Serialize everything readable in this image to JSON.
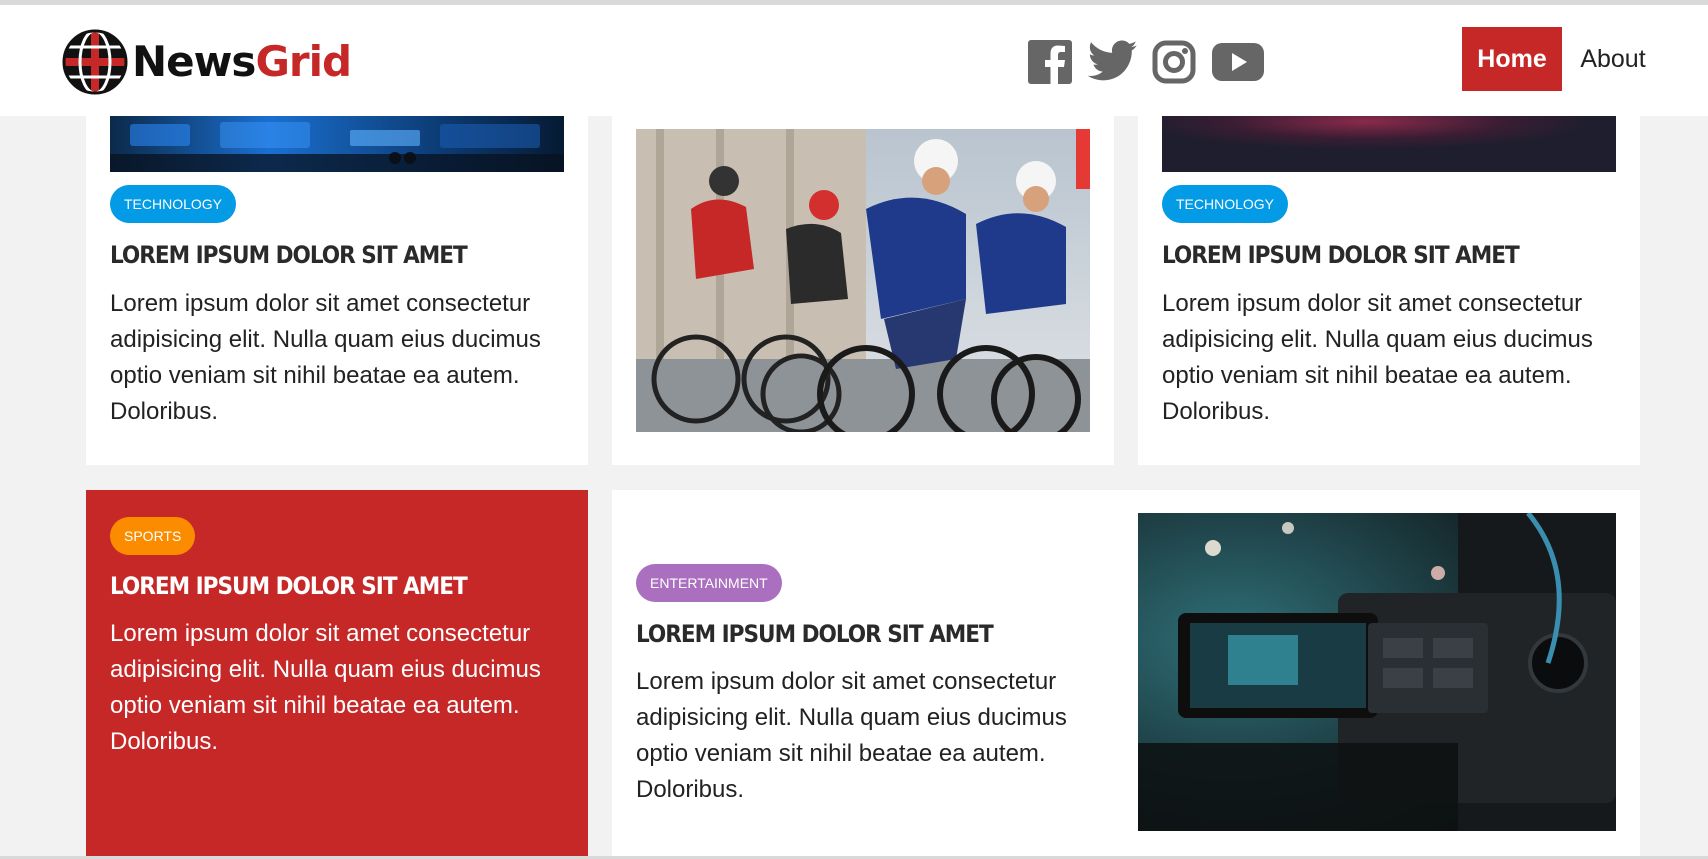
{
  "brand": {
    "name_part1": "News",
    "name_part2": "Grid"
  },
  "social": {
    "facebook": "facebook-icon",
    "twitter": "twitter-icon",
    "instagram": "instagram-icon",
    "youtube": "youtube-icon"
  },
  "nav": {
    "home": "Home",
    "about": "About"
  },
  "colors": {
    "accent": "#c62828",
    "technology": "#039be5",
    "sports": "#fb8c00",
    "entertainment": "#ab6fc0"
  },
  "cards": [
    {
      "category": "TECHNOLOGY",
      "title": "LOREM IPSUM DOLOR SIT AMET",
      "text": "Lorem ipsum dolor sit amet consectetur adipisicing elit. Nulla quam eius ducimus optio veniam sit nihil beatae ea autem. Doloribus."
    },
    {
      "image": "cyclists-racing"
    },
    {
      "category": "TECHNOLOGY",
      "title": "LOREM IPSUM DOLOR SIT AMET",
      "text": "Lorem ipsum dolor sit amet consectetur adipisicing elit. Nulla quam eius ducimus optio veniam sit nihil beatae ea autem. Doloribus."
    },
    {
      "category": "SPORTS",
      "title": "LOREM IPSUM DOLOR SIT AMET",
      "text": "Lorem ipsum dolor sit amet consectetur adipisicing elit. Nulla quam eius ducimus optio veniam sit nihil beatae ea autem. Doloribus."
    },
    {
      "category": "ENTERTAINMENT",
      "title": "LOREM IPSUM DOLOR SIT AMET",
      "text": "Lorem ipsum dolor sit amet consectetur adipisicing elit. Nulla quam eius ducimus optio veniam sit nihil beatae ea autem. Doloribus.",
      "image": "video-camera"
    }
  ]
}
